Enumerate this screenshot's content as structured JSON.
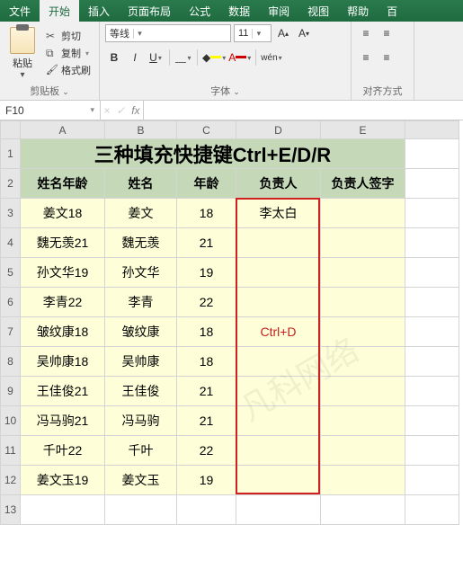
{
  "menu": {
    "file": "文件",
    "home": "开始",
    "insert": "插入",
    "layout": "页面布局",
    "formula": "公式",
    "data": "数据",
    "review": "审阅",
    "view": "视图",
    "help": "帮助",
    "bai": "百"
  },
  "ribbon": {
    "paste": "粘贴",
    "cut": "剪切",
    "copy": "复制",
    "brush": "格式刷",
    "clip_label": "剪贴板",
    "font_name": "等线",
    "font_size": "11",
    "font_label": "字体",
    "align_label": "对齐方式",
    "bold": "B",
    "italic": "I",
    "underline": "U",
    "wen": "wén"
  },
  "namebox": "F10",
  "fx": "fx",
  "cols": [
    "A",
    "B",
    "C",
    "D",
    "E"
  ],
  "title": "三种填充快捷键Ctrl+E/D/R",
  "headers": [
    "姓名年龄",
    "姓名",
    "年龄",
    "负责人",
    "负责人签字"
  ],
  "rows": [
    {
      "a": "姜文18",
      "b": "姜文",
      "c": "18",
      "d": "李太白",
      "e": ""
    },
    {
      "a": "魏无羡21",
      "b": "魏无羡",
      "c": "21",
      "d": "",
      "e": ""
    },
    {
      "a": "孙文华19",
      "b": "孙文华",
      "c": "19",
      "d": "",
      "e": ""
    },
    {
      "a": "李青22",
      "b": "李青",
      "c": "22",
      "d": "",
      "e": ""
    },
    {
      "a": "皱纹康18",
      "b": "皱纹康",
      "c": "18",
      "d": "Ctrl+D",
      "e": ""
    },
    {
      "a": "吴帅康18",
      "b": "吴帅康",
      "c": "18",
      "d": "",
      "e": ""
    },
    {
      "a": "王佳俊21",
      "b": "王佳俊",
      "c": "21",
      "d": "",
      "e": ""
    },
    {
      "a": "冯马驹21",
      "b": "冯马驹",
      "c": "21",
      "d": "",
      "e": ""
    },
    {
      "a": "千叶22",
      "b": "千叶",
      "c": "22",
      "d": "",
      "e": ""
    },
    {
      "a": "姜文玉19",
      "b": "姜文玉",
      "c": "19",
      "d": "",
      "e": ""
    }
  ],
  "watermark": "凡科网络"
}
